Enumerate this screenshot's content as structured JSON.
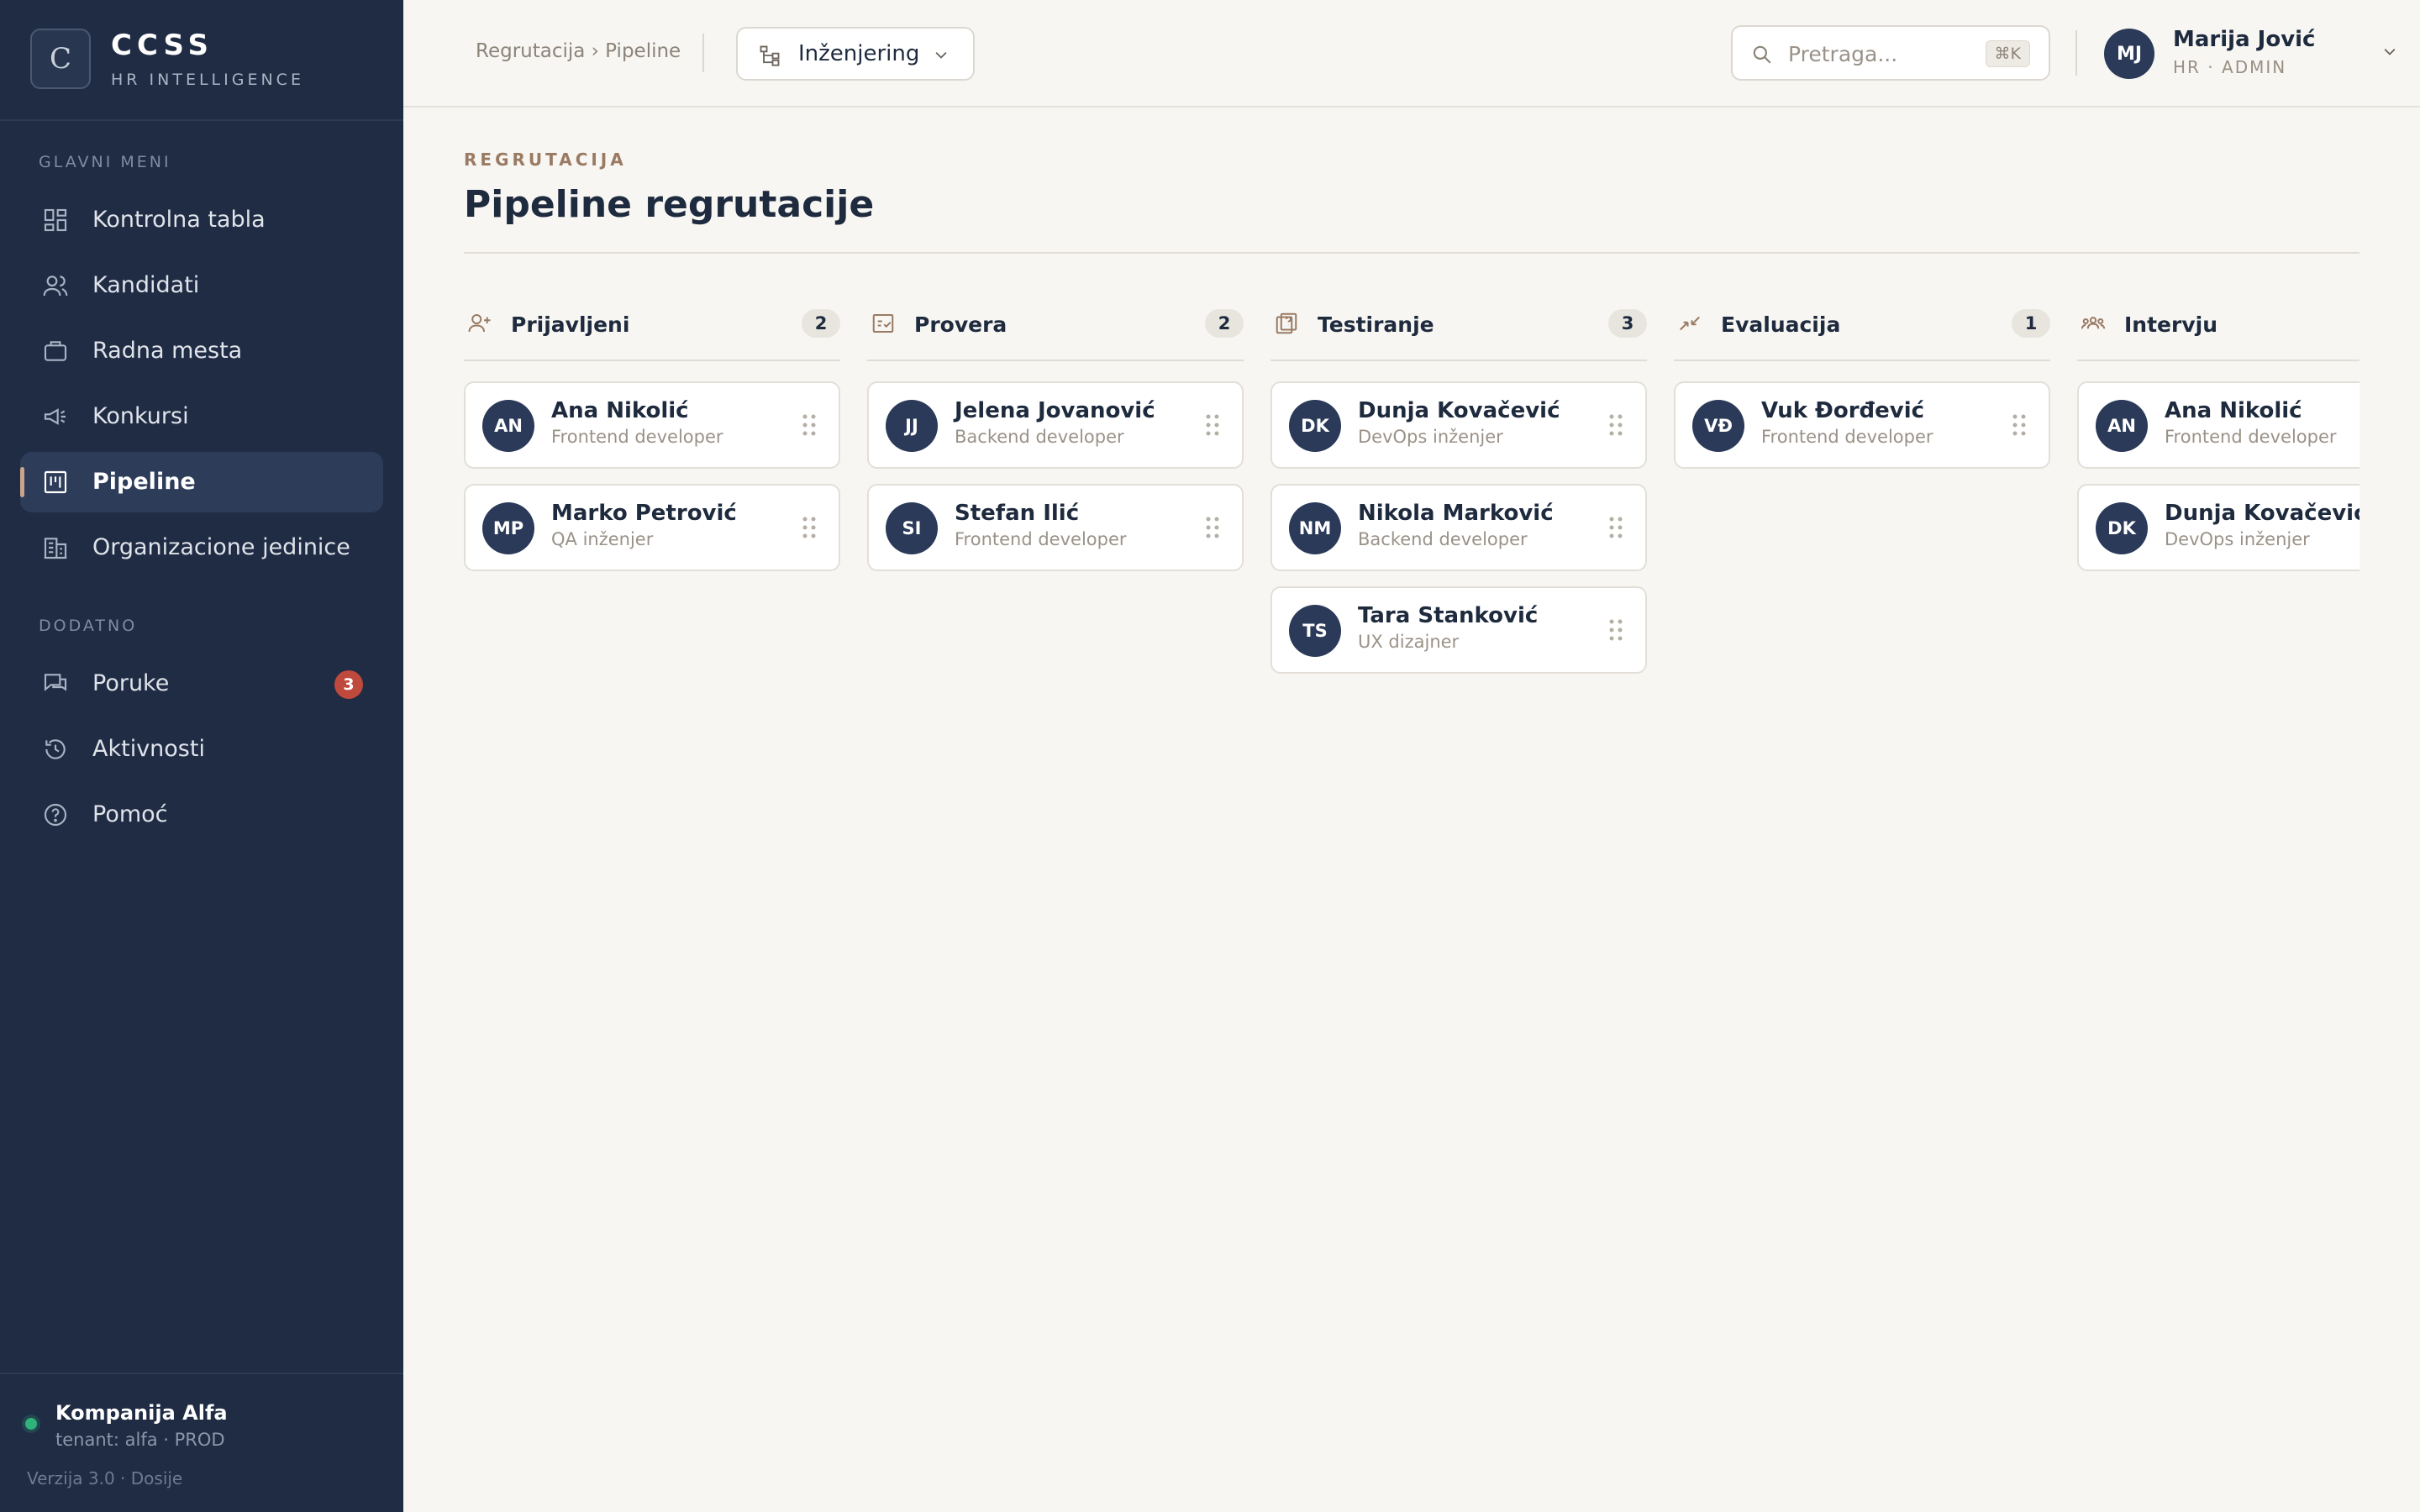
{
  "brand": {
    "logo_letter": "C",
    "name": "CCSS",
    "subtitle": "HR INTELLIGENCE"
  },
  "sidebar": {
    "section_main": "GLAVNI MENI",
    "main_items": [
      {
        "label": "Kontrolna tabla",
        "icon": "dashboard-icon"
      },
      {
        "label": "Kandidati",
        "icon": "users-icon"
      },
      {
        "label": "Radna mesta",
        "icon": "briefcase-icon"
      },
      {
        "label": "Konkursi",
        "icon": "megaphone-icon"
      },
      {
        "label": "Pipeline",
        "icon": "kanban-icon",
        "active": true
      },
      {
        "label": "Organizacione jedinice",
        "icon": "building-icon"
      }
    ],
    "section_extra": "DODATNO",
    "extra_items": [
      {
        "label": "Poruke",
        "icon": "chat-icon",
        "badge": "3"
      },
      {
        "label": "Aktivnosti",
        "icon": "history-icon"
      },
      {
        "label": "Pomoć",
        "icon": "help-icon"
      }
    ],
    "footer": {
      "tenant": "Kompanija Alfa",
      "tenant_sub": "tenant: alfa · PROD",
      "version": "Verzija 3.0 · Dosije"
    }
  },
  "header": {
    "breadcrumb": "Regrutacija › Pipeline",
    "department": "Inženjering",
    "search_placeholder": "Pretraga...",
    "search_shortcut": "⌘K",
    "user": {
      "initials": "MJ",
      "name": "Marija Jović",
      "role": "HR · ADMIN"
    }
  },
  "page": {
    "eyebrow": "REGRUTACIJA",
    "title": "Pipeline regrutacije"
  },
  "colors": {
    "sidebar_bg": "#1f2c44",
    "accent": "#c9a58c",
    "avatar_bg": "#2a3a58",
    "badge": "#c0493d",
    "status_online": "#2fb37b"
  },
  "columns": [
    {
      "title": "Prijavljeni",
      "count": "2",
      "icon": "user-plus-icon",
      "cards": [
        {
          "initials": "AN",
          "name": "Ana Nikolić",
          "role": "Frontend developer"
        },
        {
          "initials": "MP",
          "name": "Marko Petrović",
          "role": "QA inženjer"
        }
      ]
    },
    {
      "title": "Provera",
      "count": "2",
      "icon": "checklist-icon",
      "cards": [
        {
          "initials": "JJ",
          "name": "Jelena Jovanović",
          "role": "Backend developer"
        },
        {
          "initials": "SI",
          "name": "Stefan Ilić",
          "role": "Frontend developer"
        }
      ]
    },
    {
      "title": "Testiranje",
      "count": "3",
      "icon": "test-icon",
      "cards": [
        {
          "initials": "DK",
          "name": "Dunja Kovačević",
          "role": "DevOps inženjer"
        },
        {
          "initials": "NM",
          "name": "Nikola Marković",
          "role": "Backend developer"
        },
        {
          "initials": "TS",
          "name": "Tara Stanković",
          "role": "UX dizajner"
        }
      ]
    },
    {
      "title": "Evaluacija",
      "count": "1",
      "icon": "merge-icon",
      "cards": [
        {
          "initials": "VĐ",
          "name": "Vuk Đorđević",
          "role": "Frontend developer"
        }
      ]
    },
    {
      "title": "Intervju",
      "count": "",
      "icon": "group-icon",
      "cards": [
        {
          "initials": "AN",
          "name": "Ana Nikolić",
          "role": "Frontend developer"
        },
        {
          "initials": "DK",
          "name": "Dunja Kovačević",
          "role": "DevOps inženjer"
        }
      ]
    }
  ]
}
